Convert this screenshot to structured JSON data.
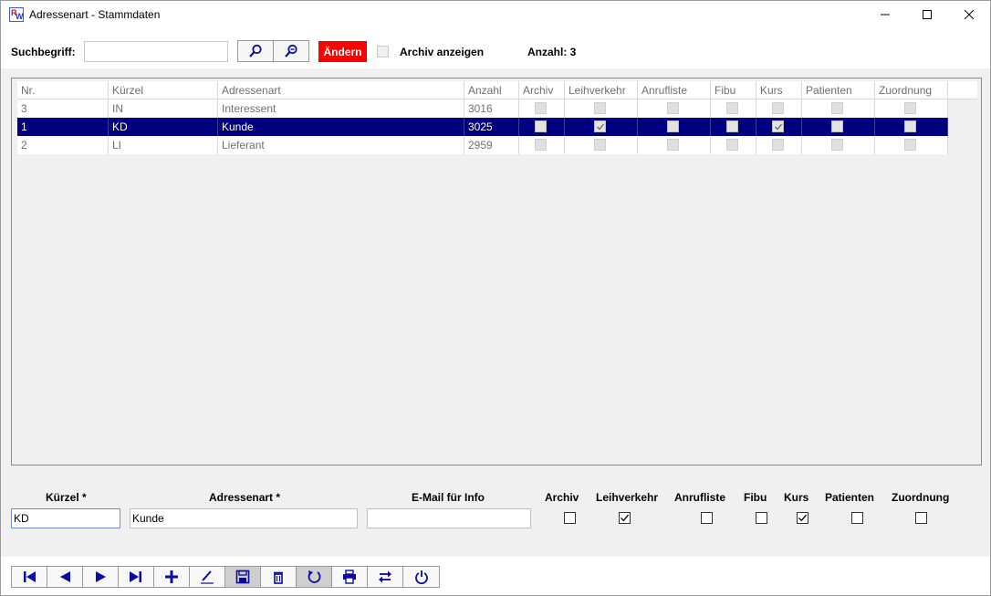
{
  "window": {
    "title": "Adressenart - Stammdaten",
    "icon_letters": [
      "R",
      "W"
    ]
  },
  "search": {
    "label": "Suchbegriff:",
    "value": "",
    "aendern_label": "Ändern",
    "archiv_label": "Archiv anzeigen",
    "archiv_checked": false,
    "count_label": "Anzahl: 3"
  },
  "grid": {
    "columns": [
      "Nr.",
      "Kürzel",
      "Adressenart",
      "Anzahl",
      "Archiv",
      "Leihverkehr",
      "Anrufliste",
      "Fibu",
      "Kurs",
      "Patienten",
      "Zuordnung"
    ],
    "rows": [
      {
        "nr": "3",
        "kuerzel": "IN",
        "adressenart": "Interessent",
        "anzahl": "3016",
        "archiv": false,
        "leihverkehr": false,
        "anrufliste": false,
        "fibu": false,
        "kurs": false,
        "patienten": false,
        "zuordnung": false,
        "selected": false
      },
      {
        "nr": "1",
        "kuerzel": "KD",
        "adressenart": "Kunde",
        "anzahl": "3025",
        "archiv": false,
        "leihverkehr": true,
        "anrufliste": false,
        "fibu": false,
        "kurs": true,
        "patienten": false,
        "zuordnung": false,
        "selected": true
      },
      {
        "nr": "2",
        "kuerzel": "LI",
        "adressenart": "Lieferant",
        "anzahl": "2959",
        "archiv": false,
        "leihverkehr": false,
        "anrufliste": false,
        "fibu": false,
        "kurs": false,
        "patienten": false,
        "zuordnung": false,
        "selected": false
      }
    ]
  },
  "form": {
    "labels": {
      "kuerzel": "Kürzel *",
      "adressenart": "Adressenart *",
      "email": "E-Mail für Info",
      "archiv": "Archiv",
      "leihverkehr": "Leihverkehr",
      "anrufliste": "Anrufliste",
      "fibu": "Fibu",
      "kurs": "Kurs",
      "patienten": "Patienten",
      "zuordnung": "Zuordnung"
    },
    "values": {
      "kuerzel": "KD",
      "adressenart": "Kunde",
      "email": ""
    },
    "checks": {
      "archiv": false,
      "leihverkehr": true,
      "anrufliste": false,
      "fibu": false,
      "kurs": true,
      "patienten": false,
      "zuordnung": false
    }
  },
  "toolbar": {
    "buttons": [
      "first-record-icon",
      "previous-record-icon",
      "next-record-icon",
      "last-record-icon",
      "add-icon",
      "edit-icon",
      "save-icon",
      "delete-icon",
      "undo-icon",
      "print-icon",
      "swap-icon",
      "power-icon"
    ],
    "pressed": [
      "save-icon",
      "undo-icon"
    ],
    "icon_color": "#0a0aa0"
  },
  "colors": {
    "selection": "#000080",
    "aendern_bg": "#ff0000",
    "icon_blue": "#0a0aa0"
  }
}
